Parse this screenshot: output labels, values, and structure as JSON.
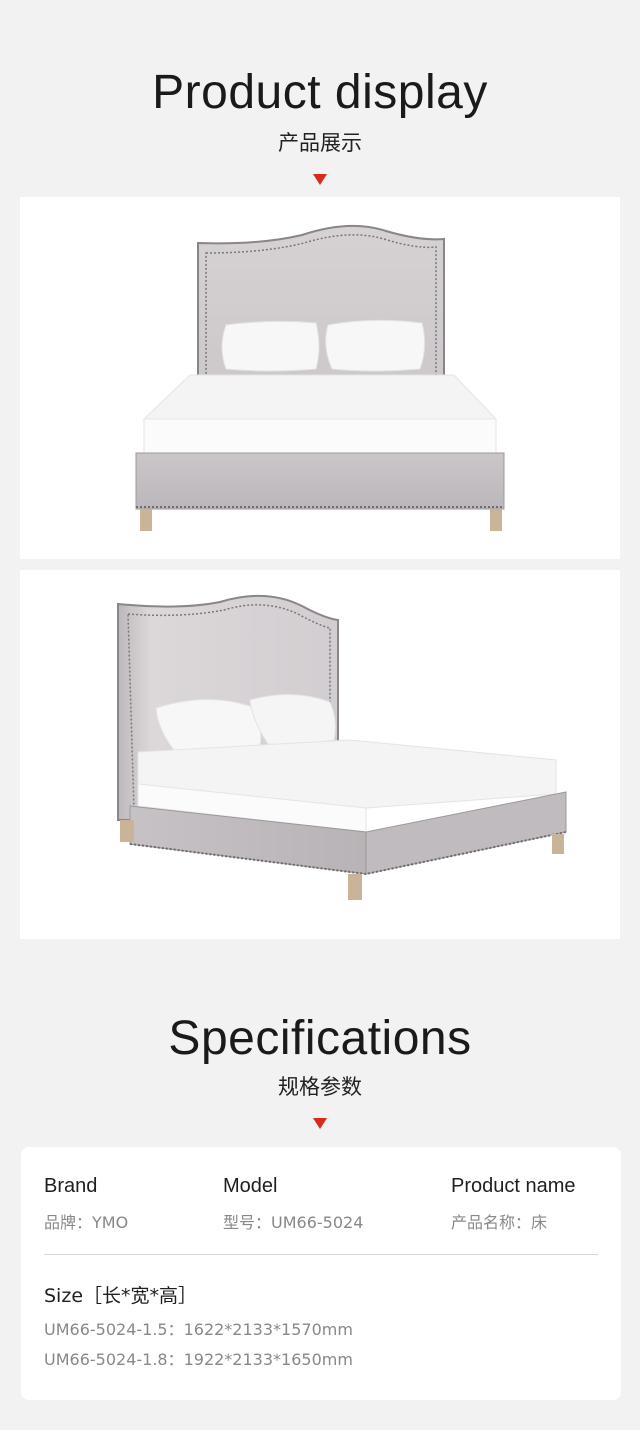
{
  "display": {
    "title_en": "Product display",
    "title_cn": "产品展示"
  },
  "specs_section": {
    "title_en": "Specifications",
    "title_cn": "规格参数"
  },
  "specs": {
    "brand": {
      "label": "Brand",
      "value": "品牌：YMO"
    },
    "model": {
      "label": "Model",
      "value": "型号：UM66-5024"
    },
    "product_name": {
      "label": "Product name",
      "value": "产品名称：床"
    },
    "size_label": "Size［长*宽*高］",
    "sizes": [
      "UM66-5024-1.5：1622*2133*1570mm",
      "UM66-5024-1.8：1922*2133*1650mm"
    ]
  },
  "colors": {
    "background": "#f2f2f2",
    "accent_arrow": "#d9281e",
    "fabric": "#cdc8cb",
    "sheet": "#ffffff"
  }
}
